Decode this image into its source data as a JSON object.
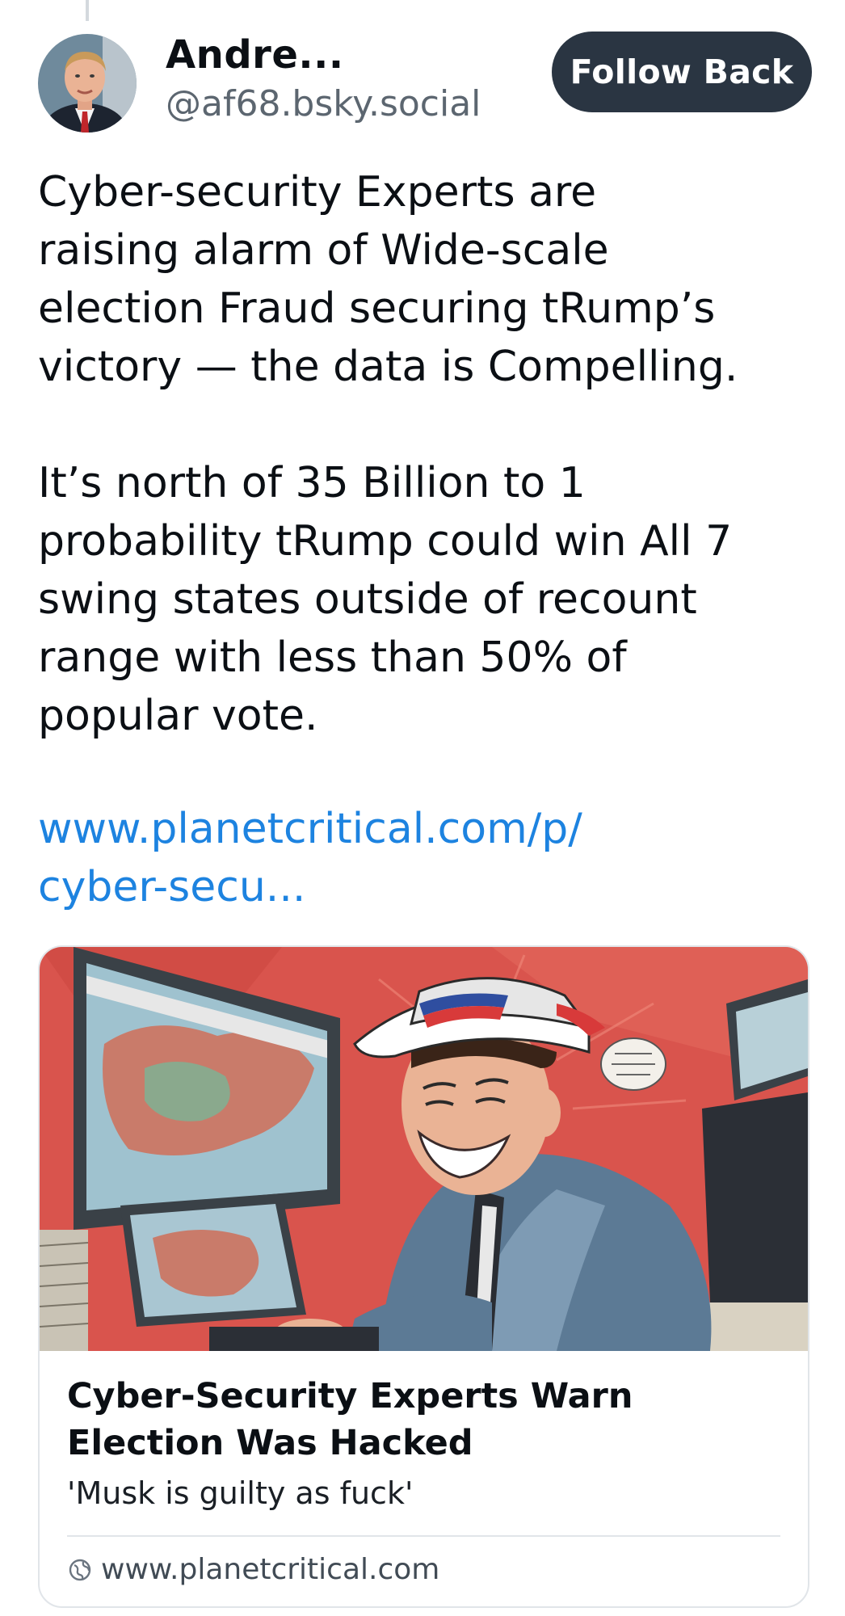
{
  "author": {
    "display_name": "Andre...",
    "handle": "@af68.bsky.social",
    "avatar_icon": "person-portrait"
  },
  "follow_button": {
    "label": "Follow Back",
    "color": "#2a3542"
  },
  "post": {
    "paragraph1": [
      "Cyber-security Experts are",
      "raising alarm of Wide-scale",
      "election Fraud securing tRump’s",
      "victory — the data is Compelling."
    ],
    "paragraph2": [
      "It’s north of 35 Billion to 1",
      "probability tRump could win All 7",
      "swing states outside of recount",
      "range with less than 50% of",
      "popular vote."
    ],
    "link_lines": [
      "www.planetcritical.com/p/",
      "cyber-secu..."
    ],
    "link_color": "#1d83e0"
  },
  "link_card": {
    "title_lines": [
      "Cyber-Security Experts Warn",
      "Election Was Hacked"
    ],
    "description": "'Musk is guilty as fuck'",
    "domain": "www.planetcritical.com",
    "domain_icon": "globe-icon"
  }
}
